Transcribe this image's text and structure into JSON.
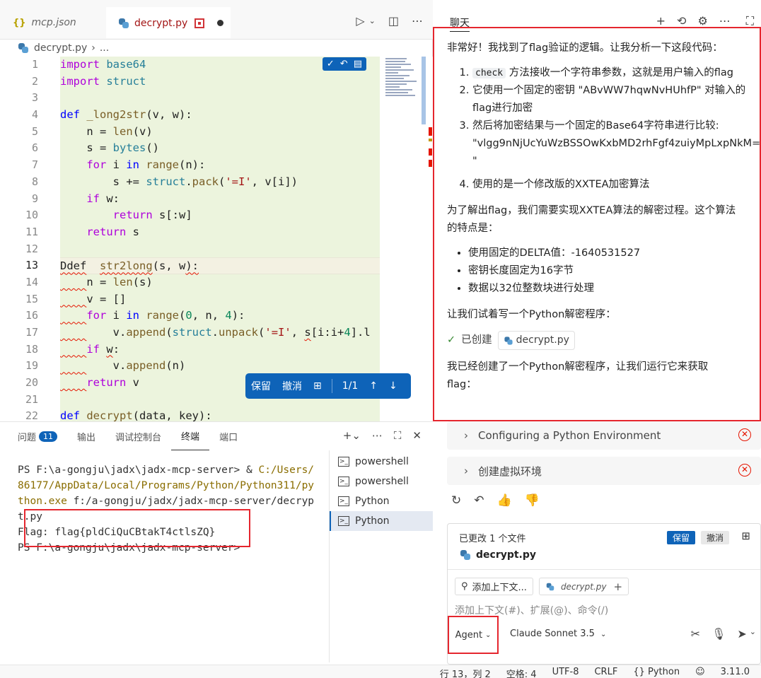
{
  "tabs": [
    {
      "label": "mcp.json",
      "icon": "braces-icon"
    },
    {
      "label": "decrypt.py",
      "icon": "python-icon"
    }
  ],
  "breadcrumb": {
    "file": "decrypt.py",
    "rest": "..."
  },
  "editor": {
    "line_numbers": [
      "1",
      "2",
      "3",
      "4",
      "5",
      "6",
      "7",
      "8",
      "9",
      "10",
      "11",
      "12",
      "13",
      "14",
      "15",
      "16",
      "17",
      "18",
      "19",
      "20",
      "21",
      "22"
    ],
    "active_line": 13
  },
  "diffbar": {
    "keep": "保留",
    "undo": "撤消",
    "count": "1/1"
  },
  "panel": {
    "tabs": [
      "问题",
      "输出",
      "调试控制台",
      "终端",
      "端口"
    ],
    "problems_count": "11",
    "active_tab": "终端"
  },
  "terminal": {
    "prompt1": "PS F:\\a-gongju\\jadx\\jadx-mcp-server> & ",
    "cmd_path": "C:/Users/86177/AppData/Local/Programs/Python/Python311/python.exe",
    "cmd_arg": " f:/a-gongju/jadx/jadx-mcp-server/decrypt.py",
    "flag_line": "Flag: flag{pldCiQuCBtakT4ctlsZQ}",
    "prompt2": "PS F:\\a-gongju\\jadx\\jadx-mcp-server>",
    "sessions": [
      "powershell",
      "powershell",
      "Python",
      "Python"
    ]
  },
  "chat": {
    "title": "聊天",
    "intro": "非常好！我找到了flag验证的逻辑。让我分析一下这段代码：",
    "steps": [
      {
        "code": "check",
        "text": " 方法接收一个字符串参数，这就是用户输入的flag"
      },
      {
        "code": "",
        "text": "它使用一个固定的密钥 \"ABvWW7hqwNvHUhfP\" 对输入的"
      },
      {
        "code": "",
        "text": "flag进行加密"
      },
      {
        "code": "",
        "text": "然后将加密结果与一个固定的Base64字符串进行比较:"
      },
      {
        "code": "",
        "text": "\"vlgg9nNjUcYuWzBSSOwKxbMD2rhFgf4zuiyMpLxpNkM="
      },
      {
        "code": "",
        "text": "\""
      },
      {
        "code": "",
        "text": "使用的是一个修改版的XXTEA加密算法"
      }
    ],
    "para2_line1": "为了解出flag，我们需要实现XXTEA算法的解密过程。这个算法",
    "para2_line2": "的特点是：",
    "bullets": [
      "使用固定的DELTA值：-1640531527",
      "密钥长度固定为16字节",
      "数据以32位整数块进行处理"
    ],
    "para3": "让我们试着写一个Python解密程序：",
    "created_label": "已创建",
    "created_file": "decrypt.py",
    "para4_line1": "我已经创建了一个Python解密程序，让我们运行它来获取",
    "para4_line2": "flag：",
    "collapsed": [
      "Configuring a Python Environment",
      "创建虚拟环境"
    ]
  },
  "composer": {
    "changed": "已更改 1 个文件",
    "keep": "保留",
    "undo": "撤消",
    "file": "decrypt.py",
    "add_context": "添加上下文...",
    "context_file": "decrypt.py",
    "placeholder": "添加上下文(#)、扩展(@)、命令(/)",
    "mode": "Agent",
    "model": "Claude Sonnet 3.5"
  },
  "status": {
    "position": "行 13，列 2",
    "spaces": "空格: 4",
    "encoding": "UTF-8",
    "eol": "CRLF",
    "language": "Python",
    "version": "3.11.0"
  },
  "colors": {
    "accent": "#0e63b8",
    "error": "#e5262e",
    "diff_bg": "#ecf4dd"
  }
}
